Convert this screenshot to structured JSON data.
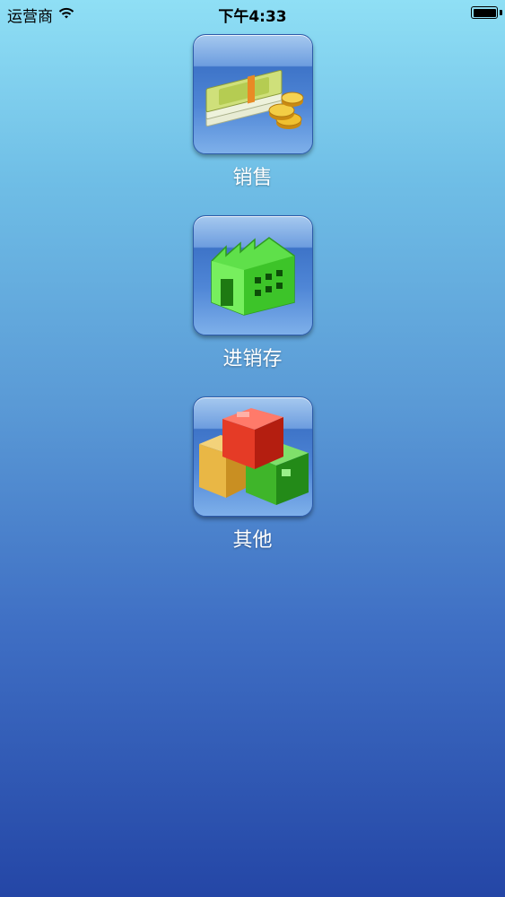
{
  "status_bar": {
    "carrier": "运营商",
    "time": "下午4:33",
    "wifi_icon": "wifi-icon",
    "battery_icon": "battery-icon"
  },
  "menu": {
    "items": [
      {
        "label": "销售",
        "icon": "money-icon"
      },
      {
        "label": "进销存",
        "icon": "factory-icon"
      },
      {
        "label": "其他",
        "icon": "boxes-icon"
      }
    ]
  },
  "colors": {
    "background_top": "#8fdff5",
    "background_bottom": "#2446a6",
    "label_text": "#ffffff"
  }
}
